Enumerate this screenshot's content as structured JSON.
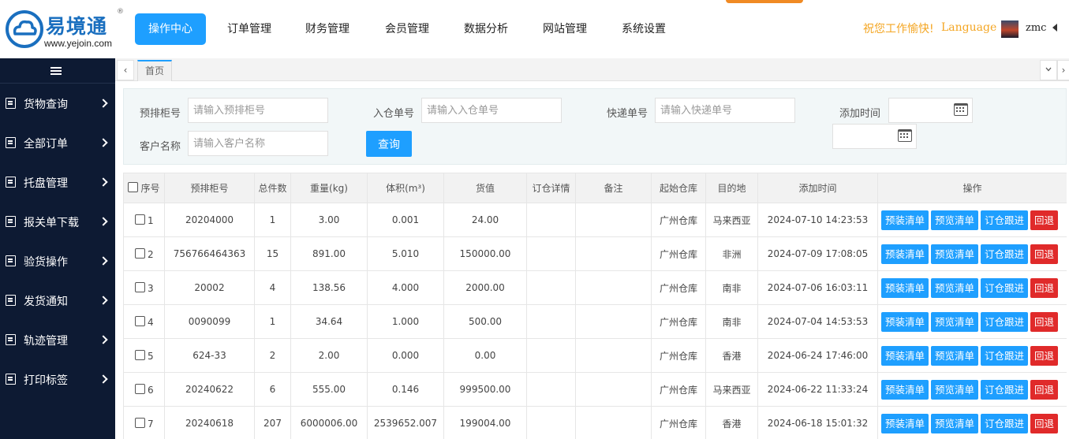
{
  "logo": {
    "name": "易境通",
    "reg": "®",
    "url": "www.yejoin.com"
  },
  "nav": {
    "items": [
      "操作中心",
      "订单管理",
      "财务管理",
      "会员管理",
      "数据分析",
      "网站管理",
      "系统设置"
    ],
    "active_index": 0
  },
  "header": {
    "greeting": "祝您工作愉快!",
    "language": "Language",
    "username": "zmc"
  },
  "sidebar": {
    "items": [
      {
        "label": "货物查询",
        "icon": "list-icon"
      },
      {
        "label": "全部订单",
        "icon": "list-icon"
      },
      {
        "label": "托盘管理",
        "icon": "list-icon"
      },
      {
        "label": "报关单下载",
        "icon": "list-icon"
      },
      {
        "label": "验货操作",
        "icon": "list-icon"
      },
      {
        "label": "发货通知",
        "icon": "list-icon"
      },
      {
        "label": "轨迹管理",
        "icon": "list-icon"
      },
      {
        "label": "打印标签",
        "icon": "list-icon"
      }
    ]
  },
  "tabs": {
    "prev": "‹",
    "next": "›",
    "items": [
      "首页"
    ]
  },
  "search": {
    "cabinet_label": "预排柜号",
    "cabinet_placeholder": "请输入预排柜号",
    "inbound_label": "入仓单号",
    "inbound_placeholder": "请输入入仓单号",
    "express_label": "快递单号",
    "express_placeholder": "请输入快递单号",
    "time_label": "添加时间",
    "customer_label": "客户名称",
    "customer_placeholder": "请输入客户名称",
    "query_button": "查询"
  },
  "table": {
    "headers": [
      "序号",
      "预排柜号",
      "总件数",
      "重量(kg)",
      "体积(m³)",
      "货值",
      "订仓详情",
      "备注",
      "起始仓库",
      "目的地",
      "添加时间",
      "操作"
    ],
    "actions": [
      "预装清单",
      "预览清单",
      "订仓跟进",
      "回退"
    ],
    "rows": [
      {
        "seq": "1",
        "cabinet": "20204000",
        "pieces": "1",
        "weight": "3.00",
        "volume": "0.001",
        "value": "24.00",
        "booking": "",
        "remark": "",
        "origin": "广州仓库",
        "dest": "马来西亚",
        "time": "2024-07-10 14:23:53"
      },
      {
        "seq": "2",
        "cabinet": "756766464363",
        "pieces": "15",
        "weight": "891.00",
        "volume": "5.010",
        "value": "150000.00",
        "booking": "",
        "remark": "",
        "origin": "广州仓库",
        "dest": "非洲",
        "time": "2024-07-09 17:08:05"
      },
      {
        "seq": "3",
        "cabinet": "20002",
        "pieces": "4",
        "weight": "138.56",
        "volume": "4.000",
        "value": "2000.00",
        "booking": "",
        "remark": "",
        "origin": "广州仓库",
        "dest": "南非",
        "time": "2024-07-06 16:03:11"
      },
      {
        "seq": "4",
        "cabinet": "0090099",
        "pieces": "1",
        "weight": "34.64",
        "volume": "1.000",
        "value": "500.00",
        "booking": "",
        "remark": "",
        "origin": "广州仓库",
        "dest": "南非",
        "time": "2024-07-04 14:53:53"
      },
      {
        "seq": "5",
        "cabinet": "624-33",
        "pieces": "2",
        "weight": "2.00",
        "volume": "0.000",
        "value": "0.00",
        "booking": "",
        "remark": "",
        "origin": "广州仓库",
        "dest": "香港",
        "time": "2024-06-24 17:46:00"
      },
      {
        "seq": "6",
        "cabinet": "20240622",
        "pieces": "6",
        "weight": "555.00",
        "volume": "0.146",
        "value": "999500.00",
        "booking": "",
        "remark": "",
        "origin": "广州仓库",
        "dest": "马来西亚",
        "time": "2024-06-22 11:33:24"
      },
      {
        "seq": "7",
        "cabinet": "20240618",
        "pieces": "207",
        "weight": "6000006.00",
        "volume": "2539652.007",
        "value": "199004.00",
        "booking": "",
        "remark": "",
        "origin": "广州仓库",
        "dest": "香港",
        "time": "2024-06-18 15:01:32"
      }
    ]
  },
  "colors": {
    "accent": "#1e9fff",
    "danger": "#e02a2a",
    "sidebar": "#0d1a33",
    "greeting": "#f4a623"
  }
}
